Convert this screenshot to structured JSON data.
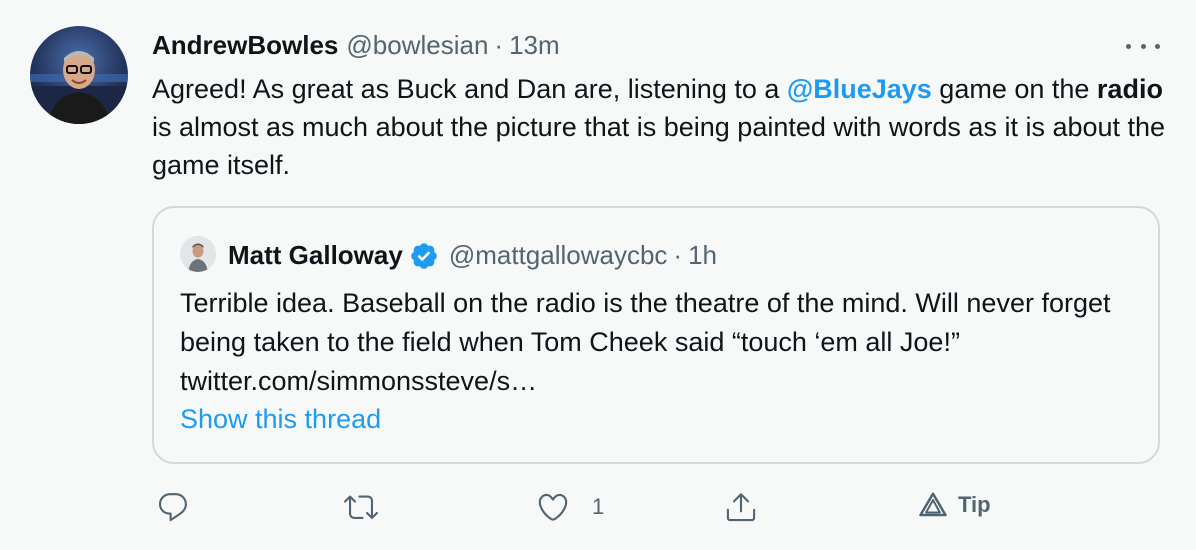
{
  "author": {
    "display_name": "AndrewBowles",
    "handle": "@bowlesian",
    "separator": "·",
    "time": "13m"
  },
  "tweet": {
    "text_parts": {
      "p1": "Agreed!  As great as Buck and Dan are, listening to a ",
      "mention": "@BlueJays",
      "p2": " game on the ",
      "bold": "radio",
      "p3": " is almost as much about the picture that is being painted with words as it is about the game itself."
    }
  },
  "quoted": {
    "display_name": "Matt Galloway",
    "handle": "@mattgallowaycbc",
    "separator": "·",
    "time": "1h",
    "text": "Terrible idea. Baseball on the radio is the theatre of the mind. Will never forget being taken to the field when Tom Cheek said “touch ‘em all Joe!” twitter.com/simmonssteve/s…",
    "show_thread": "Show this thread"
  },
  "actions": {
    "reply_count": "",
    "retweet_count": "",
    "like_count": "1",
    "tip_label": "Tip"
  },
  "colors": {
    "accent": "#1d9bf0",
    "secondary_text": "#536471",
    "border": "#cfd9de",
    "background": "#f7f9f9"
  },
  "icons": [
    "more-icon",
    "verified-icon",
    "reply-icon",
    "retweet-icon",
    "like-icon",
    "share-icon",
    "tip-icon"
  ]
}
